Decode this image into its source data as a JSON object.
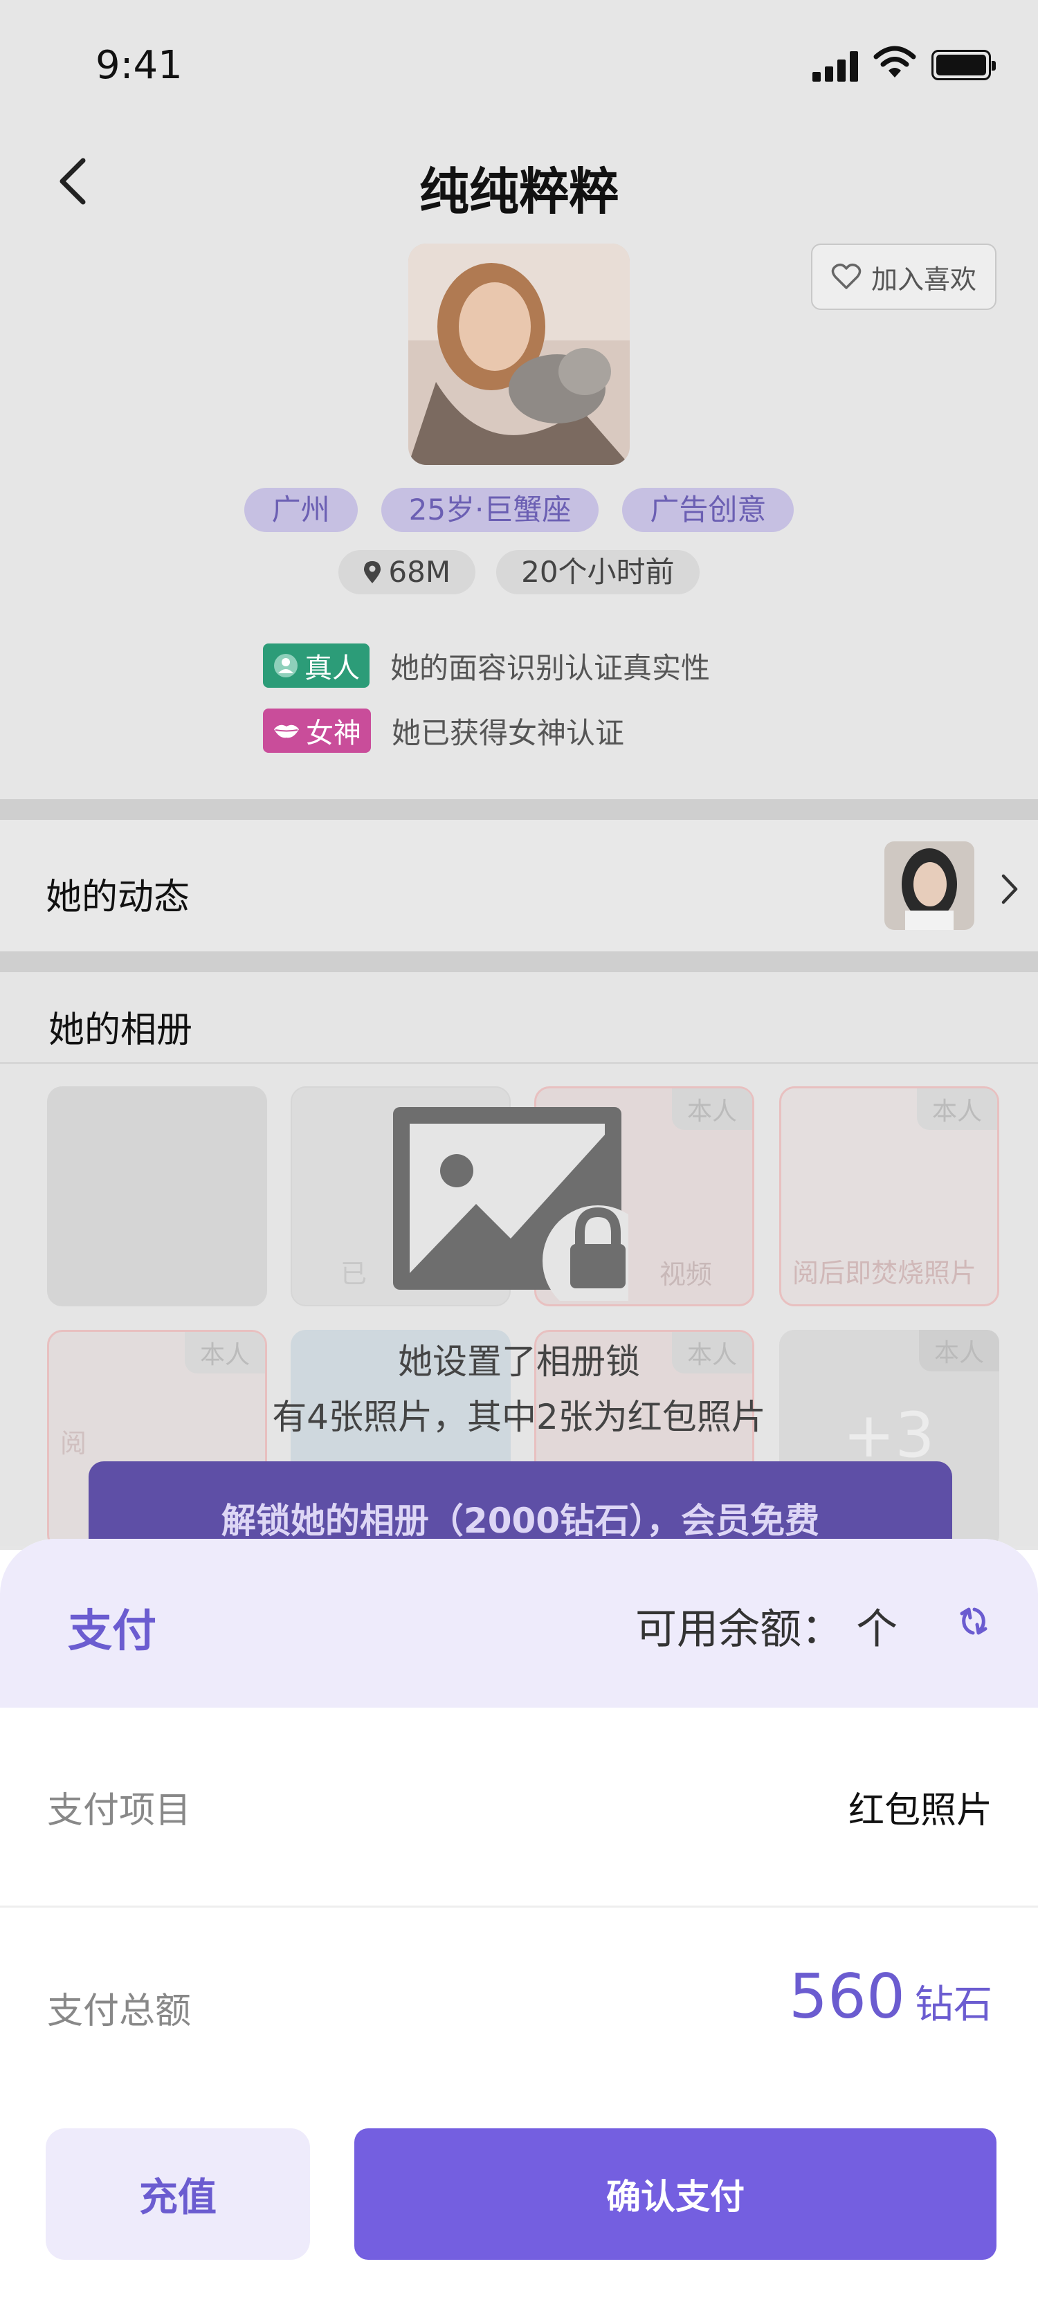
{
  "status_bar": {
    "time": "9:41"
  },
  "header": {
    "title": "纯纯粹粹",
    "like_label": "加入喜欢"
  },
  "profile": {
    "tags": [
      "广州",
      "25岁·巨蟹座",
      "广告创意"
    ],
    "distance": "68M",
    "last_active": "20个小时前",
    "certs": [
      {
        "badge": "真人",
        "text": "她的面容识别认证真实性",
        "color": "#2c9c78"
      },
      {
        "badge": "女神",
        "text": "她已获得女神认证",
        "color": "#c94d9a"
      }
    ]
  },
  "moments": {
    "title": "她的动态"
  },
  "album": {
    "title": "她的相册",
    "tile_tags": [
      "本人",
      "本人",
      "本人",
      "本人",
      "本人",
      "本人"
    ],
    "tile_texts": [
      "已",
      "视频",
      "阅后即焚烧照片",
      "阅",
      "+3"
    ],
    "lock_line1": "她设置了相册锁",
    "lock_line2": "有4张照片，其中2张为红包照片",
    "unlock_button": "解锁她的相册（2000钻石），会员免费"
  },
  "payment": {
    "title": "支付",
    "balance_label": "可用余额：  个",
    "item_label": "支付项目",
    "item_value": "红包照片",
    "total_label": "支付总额",
    "total_amount": "560",
    "total_unit": "钻石",
    "recharge_button": "充值",
    "confirm_button": "确认支付"
  },
  "colors": {
    "accent": "#745fe0",
    "accent_light": "#eeebfb",
    "overlay": "#e6e6e6"
  }
}
